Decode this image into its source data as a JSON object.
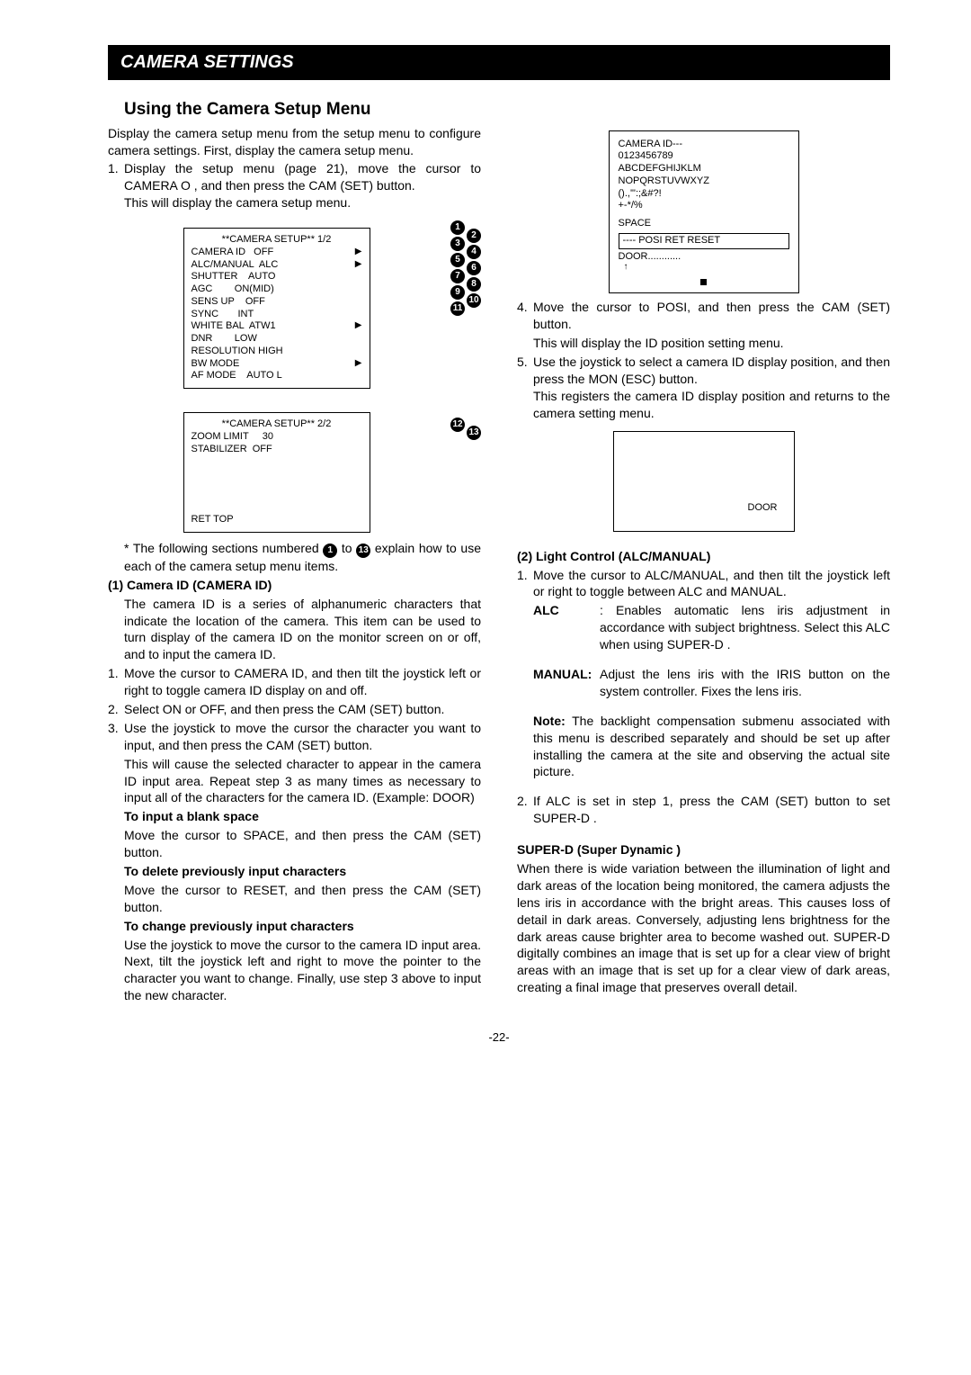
{
  "header": {
    "title": "CAMERA SETTINGS"
  },
  "section": {
    "title": "Using the Camera Setup Menu"
  },
  "left": {
    "intro": "Display the camera setup menu from the setup menu to configure camera settings. First, display the camera setup menu.",
    "s1a": "Display the setup menu (page 21), move the cursor to CAMERA O  , and then press the CAM (SET) button.",
    "s1b": "This will display the camera setup menu.",
    "menu1": {
      "title": "**CAMERA SETUP** 1/2",
      "cameraId": "CAMERA ID   OFF",
      "alc": "ALC/MANUAL  ALC",
      "shutter": "SHUTTER    AUTO",
      "agc": "AGC        ON(MID)",
      "sensup": "SENS UP    OFF",
      "sync": "SYNC       INT",
      "wb": "WHITE BAL  ATW1",
      "dnr": "DNR        LOW",
      "res": "RESOLUTION HIGH",
      "bw": "BW MODE",
      "af": "AF MODE    AUTO L"
    },
    "menu2": {
      "title": "**CAMERA SETUP** 2/2",
      "zoom": "ZOOM LIMIT     30",
      "stab": "STABILIZER  OFF",
      "footer": "RET  TOP"
    },
    "cap1": {
      "c1": "1",
      "c2": "2",
      "c3": "3",
      "c4": "4",
      "c5": "5",
      "c6": "6",
      "c7": "7",
      "c8": "8",
      "c9": "9",
      "c10": "10",
      "c11": "11"
    },
    "cap2": {
      "c12": "12",
      "c13": "13"
    },
    "starline_a": "* The following sections numbered ",
    "starline_b": " to ",
    "starline_c": " explain how to use each of the camera setup menu items.",
    "h1": "(1) Camera ID (CAMERA ID)",
    "p1": "The camera ID is a series of alphanumeric characters that indicate the location of the camera. This item can be used to turn display of the camera ID on the monitor screen on or off, and to input the camera ID.",
    "s1c": "Move the cursor to CAMERA ID, and then tilt the joystick left or right to toggle camera ID display on and off.",
    "s2": "Select ON or OFF, and then press the CAM (SET) button.",
    "s3a": "Use the joystick to move the cursor the character you want to input, and then press the CAM (SET) button.",
    "s3b": "This will cause the selected character to appear in the camera ID input area. Repeat step 3 as many times as necessary to input all of the characters for the camera ID. (Example: DOOR)",
    "h2": "To input a blank space",
    "p2": "Move the cursor to SPACE, and then press the CAM (SET) button.",
    "h3": "To delete previously input characters",
    "p3": "Move the cursor to RESET, and then press the CAM (SET) button.",
    "h4": "To change previously input characters",
    "p4": "Use the joystick to move the cursor to the camera ID input area. Next, tilt the joystick left and right to move the   pointer to the character you want to change. Finally, use step 3 above to input the new character."
  },
  "right": {
    "idpanel": {
      "l1": "CAMERA ID---",
      "l2": "0123456789",
      "l3": "ABCDEFGHIJKLM",
      "l4": "NOPQRSTUVWXYZ",
      "l5": "().,'\":;&#?!",
      "l6": "+-*/%",
      "space": "SPACE",
      "posi": "---- POSI RET RESET",
      "door": "DOOR............"
    },
    "s4a": "Move the cursor to POSI, and then press the CAM (SET) button.",
    "s4b": "This will display the ID position setting menu.",
    "s5a": "Use the joystick to select a camera ID display position, and then press the MON (ESC) button.",
    "s5b": "This registers the camera ID display position and returns to the camera setting menu.",
    "doorlabel": "DOOR",
    "h5": "(2) Light Control (ALC/MANUAL)",
    "s21": "Move the cursor to ALC/MANUAL, and then tilt the joystick left or right to toggle between ALC and MANUAL.",
    "alcTerm": "ALC",
    "alcDesc": ": Enables automatic lens iris adjustment in accordance with subject brightness. Select this ALC when using SUPER-D   .",
    "manTerm": "MANUAL:",
    "manDesc": "Adjust the lens iris with the IRIS button on the system controller. Fixes the lens iris.",
    "noteTerm": "Note:",
    "note": "The backlight compensation submenu associated with this menu is described separately and should be set up after installing the camera at the site and observing the actual site picture.",
    "s22": "If ALC is set in step 1, press the CAM (SET) button to set SUPER-D   .",
    "h6": "SUPER-D    (Super Dynamic   )",
    "p6": "When there is wide variation between the illumination of light and dark areas of the location being monitored, the camera adjusts the lens iris in accordance with the bright areas. This causes loss of detail in dark areas. Conversely, adjusting lens brightness for the dark areas cause brighter area to become washed out. SUPER-D   digitally combines an image that is set up for a clear view of bright areas with an image that is set up for a clear view of dark areas, creating a final image that preserves overall detail."
  },
  "footer": {
    "page": "-22-"
  }
}
